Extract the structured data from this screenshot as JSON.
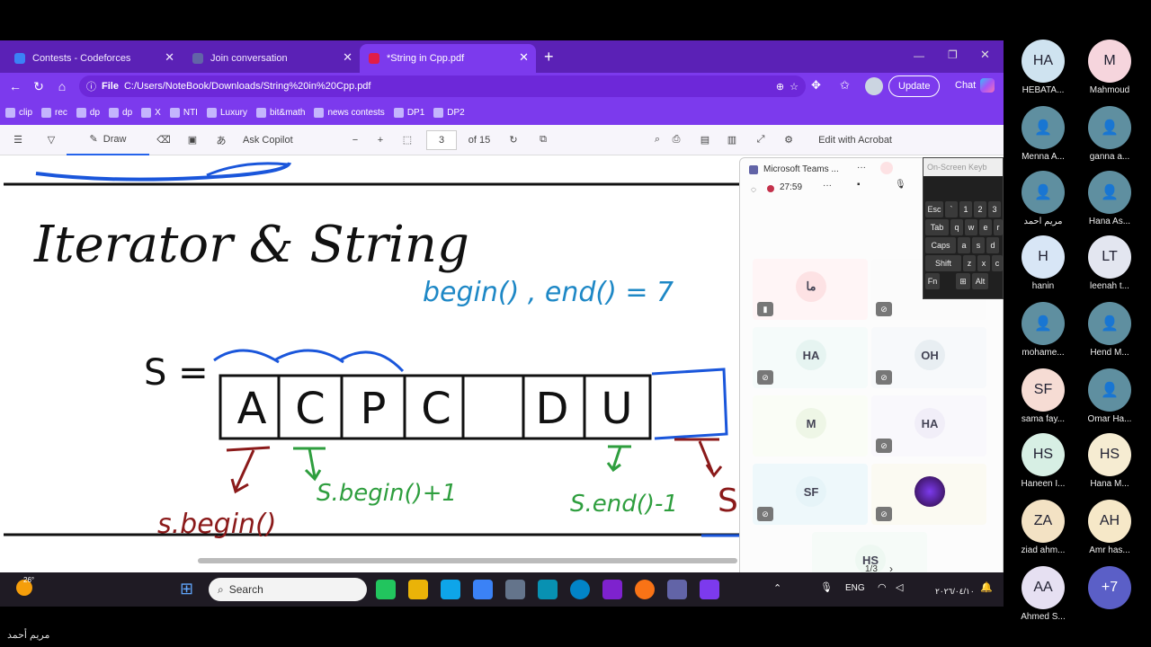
{
  "browser": {
    "tabs": [
      {
        "label": "Contests - Codeforces",
        "favicon_color": "#3b82f6"
      },
      {
        "label": "Join conversation",
        "favicon_color": "#6264a7"
      },
      {
        "label": "*String in Cpp.pdf",
        "favicon_color": "#e11d48"
      }
    ],
    "new_tab": "+",
    "address_prefix": "File",
    "address": "C:/Users/NoteBook/Downloads/String%20in%20Cpp.pdf",
    "update_label": "Update",
    "chat_label": "Chat",
    "bookmarks": [
      "clip",
      "rec",
      "dp",
      "dp",
      "X",
      "NTI",
      "Luxury",
      "bit&math",
      "news contests",
      "DP1",
      "DP2"
    ]
  },
  "pdf_toolbar": {
    "draw_label": "Draw",
    "ask_copilot": "Ask Copilot",
    "page_current": "3",
    "page_total": "of 15",
    "acrobat_label": "Edit with Acrobat",
    "minus": "−",
    "plus": "+"
  },
  "slide": {
    "title": "Iterator & String",
    "s_label": "S =",
    "cells": [
      "A",
      "C",
      "P",
      "C",
      "",
      "D",
      "U",
      ""
    ],
    "begin_end_note": "begin() , end() = 7",
    "begin_label": "s.begin()",
    "begin_plus": "S.begin()+1",
    "end_minus": "S.end()-1",
    "end_partial": "S"
  },
  "teams_popup": {
    "title": "Microsoft Teams ...",
    "timer": "27:59",
    "pager": "1/3",
    "tiles": [
      {
        "initials": "ما",
        "bg": "#fde2e4"
      },
      {
        "initials": "HA",
        "bg": "#e6f4f1"
      },
      {
        "initials": "OH",
        "bg": "#e8eef2"
      },
      {
        "initials": "M",
        "bg": "#eef6e6"
      },
      {
        "initials": "HA",
        "bg": "#f1eef8"
      },
      {
        "initials": "SF",
        "bg": "#e6f4f8"
      },
      {
        "initials": "",
        "bg": "#2a0a3a"
      },
      {
        "initials": "HS",
        "bg": "#eef8f2"
      }
    ]
  },
  "osk": {
    "title": "On-Screen Keyb",
    "rows": [
      [
        "Esc",
        "`",
        "1",
        "2",
        "3"
      ],
      [
        "Tab",
        "q",
        "w",
        "e",
        "r"
      ],
      [
        "Caps",
        "a",
        "s",
        "d"
      ],
      [
        "Shift",
        "z",
        "x",
        "c"
      ],
      [
        "Fn",
        "",
        "Alt"
      ]
    ]
  },
  "taskbar": {
    "temp": "26°",
    "search_placeholder": "Search",
    "lang": "ENG",
    "date": "٢٠٢٦/٠٤/١٠"
  },
  "participants": [
    {
      "initials": "HA",
      "name": "HEBATA...",
      "bg": "#cfe3f0"
    },
    {
      "initials": "M",
      "name": "Mahmoud",
      "bg": "#f6d5dd"
    },
    {
      "initials": "",
      "name": "Menna A...",
      "bg": "#5f8fa0"
    },
    {
      "initials": "",
      "name": "ganna a...",
      "bg": "#5f8fa0"
    },
    {
      "initials": "",
      "name": "مريم أحمد",
      "bg": "#5f8fa0"
    },
    {
      "initials": "",
      "name": "Hana As...",
      "bg": "#5f8fa0"
    },
    {
      "initials": "H",
      "name": "hanin",
      "bg": "#d8e6f6"
    },
    {
      "initials": "LT",
      "name": "leenah t...",
      "bg": "#e3e6f0"
    },
    {
      "initials": "",
      "name": "mohame...",
      "bg": "#5f8fa0"
    },
    {
      "initials": "",
      "name": "Hend M...",
      "bg": "#5f8fa0"
    },
    {
      "initials": "SF",
      "name": "sama fay...",
      "bg": "#f6dcd4"
    },
    {
      "initials": "",
      "name": "Omar Ha...",
      "bg": "#5f8fa0"
    },
    {
      "initials": "HS",
      "name": "Haneen I...",
      "bg": "#d7efe4"
    },
    {
      "initials": "HS",
      "name": "Hana M...",
      "bg": "#f6ecd2"
    },
    {
      "initials": "ZA",
      "name": "ziad ahm...",
      "bg": "#f3e2c4"
    },
    {
      "initials": "AH",
      "name": "Amr has...",
      "bg": "#f6e8c8"
    },
    {
      "initials": "AA",
      "name": "Ahmed S...",
      "bg": "#e6e0f2"
    },
    {
      "initials": "+7",
      "name": "",
      "bg": "#5b5fc7"
    }
  ],
  "presenter_name": "مريم أحمد"
}
